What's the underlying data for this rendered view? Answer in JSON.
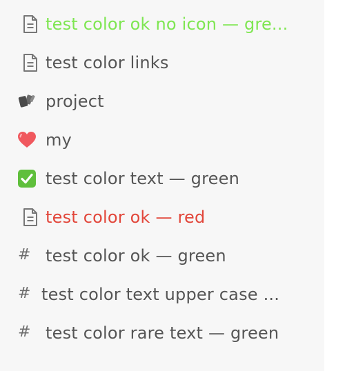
{
  "colors": {
    "default_text": "#555555",
    "green_text": "#7ee651",
    "red_text": "#e2463a",
    "icon_gray": "#777777",
    "background": "#f7f7f7"
  },
  "sidebar": {
    "items": [
      {
        "label": "test color ok no icon — gre...",
        "icon": "document-icon",
        "color": "green"
      },
      {
        "label": "test color links",
        "icon": "document-icon",
        "color": "default"
      },
      {
        "label": "project",
        "icon": "cards-icon",
        "color": "default"
      },
      {
        "label": "my",
        "icon": "red-heart-icon",
        "color": "default"
      },
      {
        "label": "test color text — green",
        "icon": "check-mark-icon",
        "color": "default"
      },
      {
        "label": "test color ok — red",
        "icon": "document-icon",
        "color": "red"
      },
      {
        "label": "test color ok — green",
        "icon": "hash-icon",
        "color": "default",
        "hash": "#"
      },
      {
        "label": "test color text upper case ...",
        "icon": "hash-icon",
        "color": "default",
        "hash": "#"
      },
      {
        "label": "test color rare text — green",
        "icon": "hash-icon",
        "color": "default",
        "hash": "#"
      }
    ]
  }
}
